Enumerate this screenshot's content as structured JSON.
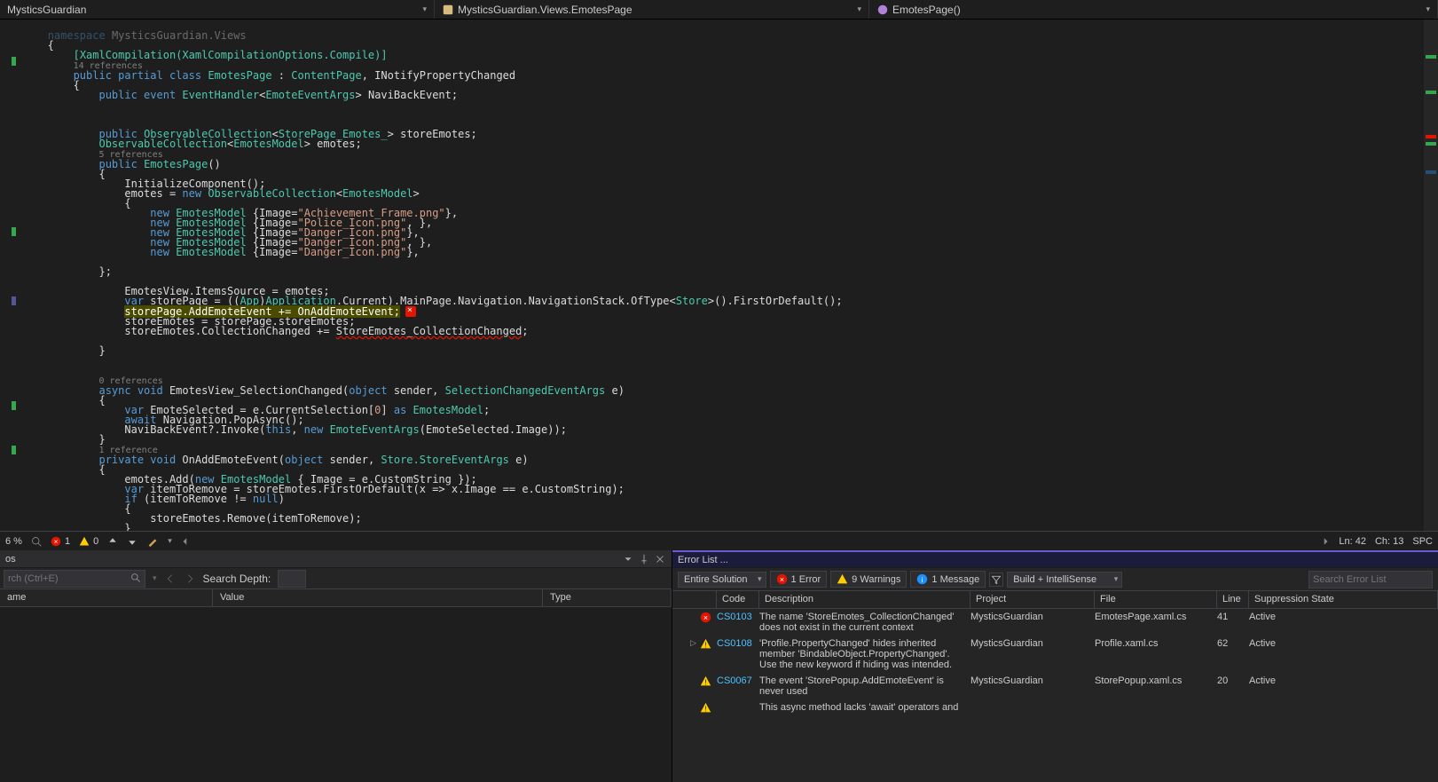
{
  "nav": {
    "project": "MysticsGuardian",
    "type": "MysticsGuardian.Views.EmotesPage",
    "member": "EmotesPage()"
  },
  "code_refs": {
    "r14": "14 references",
    "r5": "5 references",
    "r0": "0 references",
    "r1": "1 reference"
  },
  "code": {
    "namespace_kw": "namespace",
    "namespace_v": " MysticsGuardian.Views",
    "attr": "[XamlCompilation(XamlCompilationOptions.Compile)]",
    "cls1": "public partial class ",
    "cls2": "EmotesPage",
    "cls3": " : ",
    "cls4": "ContentPage",
    "cls5": ", INotifyPropertyChanged",
    "evt": "public event EventHandler<EmoteEventArgs> NaviBackEvent;",
    "f1": "public ObservableCollection<StorePage_Emotes_> storeEmotes;",
    "f2": "ObservableCollection<EmotesModel> emotes;",
    "ctor": "public EmotesPage()",
    "init": "InitializeComponent();",
    "emnew": "emotes = new ObservableCollection<EmotesModel>",
    "m1": "new EmotesModel {Image=\"Achievement_Frame.png\"},",
    "m2": "new EmotesModel {Image=\"Police_Icon.png\", },",
    "m3": "new EmotesModel {Image=\"Danger_Icon.png\"},",
    "m4": "new EmotesModel {Image=\"Danger_Icon.png\", },",
    "m5": "new EmotesModel {Image=\"Danger_Icon.png\"},",
    "src": "EmotesView.ItemsSource = emotes;",
    "sp": "var storePage = ((App)Application.Current).MainPage.Navigation.NavigationStack.OfType<Store>().FirstOrDefault();",
    "hl": "storePage.AddEmoteEvent += OnAddEmoteEvent;",
    "se": "storeEmotes = storePage.storeEmotes;",
    "cc": "storeEmotes.CollectionChanged += StoreEmotes_CollectionChanged;",
    "sc1": "async void EmotesView_SelectionChanged(object sender, SelectionChangedEventArgs e)",
    "sc2": "var EmoteSelected = e.CurrentSelection[0] as EmotesModel;",
    "sc3": "await Navigation.PopAsync();",
    "sc4": "NaviBackEvent?.Invoke(this, new EmoteEventArgs(EmoteSelected.Image));",
    "ad1": "private void OnAddEmoteEvent(object sender, Store.StoreEventArgs e)",
    "ad2": "emotes.Add(new EmotesModel { Image = e.CustomString });",
    "ad3": "var itemToRemove = storeEmotes.FirstOrDefault(x => x.Image == e.CustomString);",
    "ad4": "if (itemToRemove != null)",
    "ad5": "storeEmotes.Remove(itemToRemove);"
  },
  "status": {
    "pct": "6 %",
    "errors": "1",
    "warnings": "0",
    "ln": "Ln: 42",
    "ch": "Ch: 13",
    "spc": "SPC"
  },
  "autos": {
    "title": "os",
    "search_ph": "rch (Ctrl+E)",
    "depth_label": "Search Depth:",
    "col_name": "ame",
    "col_value": "Value",
    "col_type": "Type"
  },
  "errlist": {
    "title": "Error List ...",
    "scope": "Entire Solution",
    "errs": "1 Error",
    "wrns": "9 Warnings",
    "msgs": "1 Message",
    "build": "Build + IntelliSense",
    "search_ph": "Search Error List",
    "cols": {
      "code": "Code",
      "desc": "Description",
      "proj": "Project",
      "file": "File",
      "line": "Line",
      "sup": "Suppression State"
    },
    "rows": [
      {
        "sev": "err",
        "code": "CS0103",
        "desc": "The name 'StoreEmotes_CollectionChanged' does not exist in the current context",
        "proj": "MysticsGuardian",
        "file": "EmotesPage.xaml.cs",
        "line": "41",
        "sup": "Active"
      },
      {
        "sev": "wrn",
        "expand": true,
        "code": "CS0108",
        "desc": "'Profile.PropertyChanged' hides inherited member 'BindableObject.PropertyChanged'. Use the new keyword if hiding was intended.",
        "proj": "MysticsGuardian",
        "file": "Profile.xaml.cs",
        "line": "62",
        "sup": "Active"
      },
      {
        "sev": "wrn",
        "code": "CS0067",
        "desc": "The event 'StorePopup.AddEmoteEvent' is never used",
        "proj": "MysticsGuardian",
        "file": "StorePopup.xaml.cs",
        "line": "20",
        "sup": "Active"
      },
      {
        "sev": "wrn",
        "code": "",
        "desc": "This async method lacks 'await' operators and",
        "proj": "",
        "file": "",
        "line": "",
        "sup": ""
      }
    ]
  }
}
